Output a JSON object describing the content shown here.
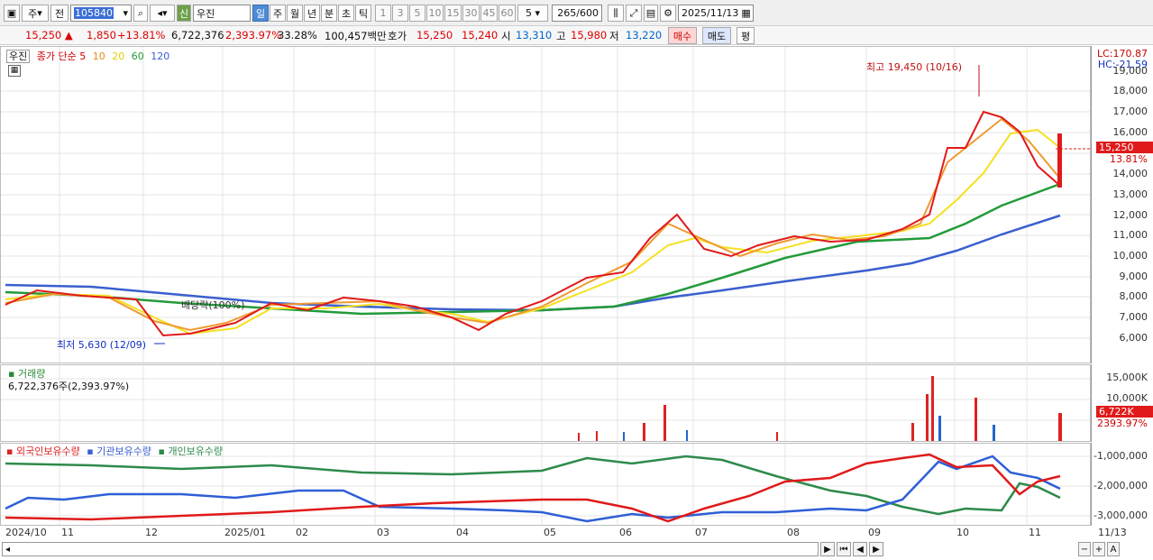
{
  "toolbar": {
    "market": "주",
    "prev": "전",
    "code": "105840",
    "name_badge": "신",
    "name": "우진",
    "periods": [
      "일",
      "주",
      "월",
      "년",
      "분",
      "초",
      "틱"
    ],
    "minutes": [
      "1",
      "3",
      "5",
      "10",
      "15",
      "30",
      "45",
      "60"
    ],
    "minute_sel": "5",
    "count": "265/600",
    "date": "2025/11/13"
  },
  "quote": {
    "price": "15,250",
    "change": "1,850",
    "rate": "+13.81%",
    "volume": "6,722,376",
    "vol_rate": "2,393.97%",
    "turnover": "33.28%",
    "amount": "100,457백만",
    "ask_label": "호가",
    "ask": "15,250",
    "bid": "15,240",
    "open_label": "시",
    "open": "13,310",
    "high_label": "고",
    "high": "15,980",
    "low_label": "저",
    "low": "13,220",
    "buy": "매수",
    "sell": "매도",
    "avg": "평"
  },
  "price_chart": {
    "name": "우진",
    "series_label": "종가 단순",
    "ma": [
      "5",
      "10",
      "20",
      "60",
      "120"
    ],
    "lc": "LC:170.87",
    "hc": "HC:-21.59",
    "high_note": "최고 19,450 (10/16)",
    "low_note": "최저 5,630 (12/09)",
    "div_note": "배당락(100%)",
    "price_tag": "15,250",
    "pct_tag": "13.81%",
    "ticks": [
      "19,000",
      "18,000",
      "17,000",
      "16,000",
      "14,000",
      "13,000",
      "12,000",
      "11,000",
      "10,000",
      "9,000",
      "8,000",
      "7,000",
      "6,000"
    ]
  },
  "volume_chart": {
    "title": "거래량",
    "value": "6,722,376주(2,393.97%)",
    "tag": "6,722K",
    "pct": "2393.97%",
    "ticks": [
      "15,000K",
      "10,000K",
      "5,000K"
    ]
  },
  "holding_chart": {
    "legend": [
      "외국인보유수량",
      "기관보유수량",
      "개인보유수량"
    ],
    "ticks": [
      "-1,000,000",
      "-2,000,000",
      "-3,000,000"
    ]
  },
  "x_axis": [
    "2024/10",
    "11",
    "12",
    "2025/01",
    "02",
    "03",
    "04",
    "05",
    "06",
    "07",
    "08",
    "09",
    "10",
    "11",
    "11/13"
  ],
  "chart_data": {
    "type": "line",
    "x": [
      "2024/10",
      "11",
      "12",
      "2025/01",
      "02",
      "03",
      "04",
      "05",
      "06",
      "07",
      "08",
      "09",
      "10",
      "11"
    ],
    "series": [
      {
        "name": "종가",
        "values": [
          8200,
          8000,
          6200,
          6800,
          7900,
          7600,
          6500,
          7800,
          10200,
          10400,
          11000,
          11400,
          17000,
          13500
        ]
      }
    ],
    "high": 19450,
    "low": 5630,
    "last": 15250,
    "ylim": [
      5000,
      19500
    ]
  }
}
